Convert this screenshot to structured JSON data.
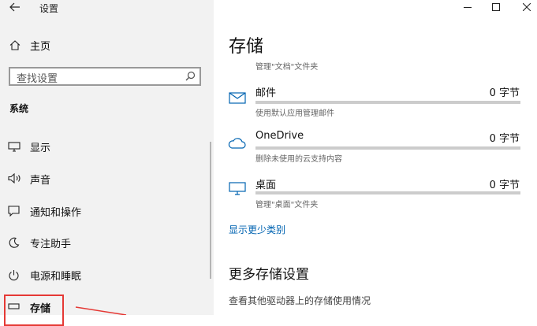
{
  "window": {
    "title": "设置"
  },
  "sidebar": {
    "home_label": "主页",
    "search_placeholder": "查找设置",
    "section_title": "系统",
    "items": [
      {
        "label": "显示",
        "icon": "monitor-icon"
      },
      {
        "label": "声音",
        "icon": "speaker-icon"
      },
      {
        "label": "通知和操作",
        "icon": "notification-icon"
      },
      {
        "label": "专注助手",
        "icon": "focus-assist-icon"
      },
      {
        "label": "电源和睡眠",
        "icon": "power-icon"
      },
      {
        "label": "存储",
        "icon": "storage-icon",
        "selected": true
      }
    ]
  },
  "main": {
    "page_title": "存储",
    "top_desc": "管理\"文档\"文件夹",
    "storage_items": [
      {
        "name": "邮件",
        "size": "0 字节",
        "desc": "使用默认应用管理邮件",
        "icon": "mail-icon"
      },
      {
        "name": "OneDrive",
        "size": "0 字节",
        "desc": "删除未使用的云支持内容",
        "icon": "cloud-icon"
      },
      {
        "name": "桌面",
        "size": "0 字节",
        "desc": "管理\"桌面\"文件夹",
        "icon": "desktop-icon"
      }
    ],
    "show_fewer_link": "显示更少类别",
    "more_settings_heading": "更多存储设置",
    "more_settings_desc": "查看其他驱动器上的存储使用情况"
  },
  "colors": {
    "accent": "#0063b1",
    "highlight": "#e53935",
    "sidebar_bg": "#f2f2f2"
  }
}
